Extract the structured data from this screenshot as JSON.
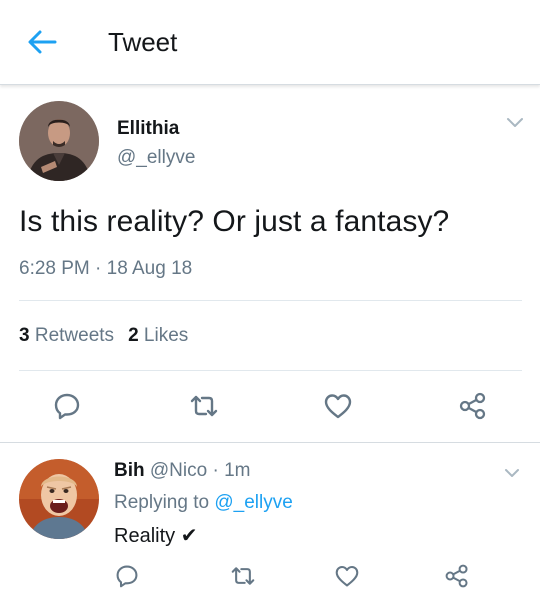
{
  "header": {
    "title": "Tweet",
    "back_icon": "arrow-left-icon",
    "accent": "#1da1f2"
  },
  "tweet": {
    "author_name": "Ellithia",
    "author_handle": "@_ellyve",
    "text": "Is this reality? Or just a fantasy?",
    "timestamp": "6:28 PM · 18 Aug 18",
    "retweets_count": "3",
    "retweets_label": "Retweets",
    "likes_count": "2",
    "likes_label": "Likes",
    "actions": [
      "reply-icon",
      "retweet-icon",
      "like-icon",
      "share-icon"
    ]
  },
  "reply": {
    "author_name": "Bih",
    "author_handle": "@Nico",
    "time": "1m",
    "replying_to_label": "Replying to",
    "replying_to_handle": "@_ellyve",
    "text": "Reality ✔",
    "actions": [
      "reply-icon",
      "retweet-icon",
      "like-icon",
      "share-icon"
    ]
  },
  "colors": {
    "text": "#14171a",
    "muted": "#657786",
    "link": "#1da1f2",
    "divider": "#e1e8ed"
  }
}
